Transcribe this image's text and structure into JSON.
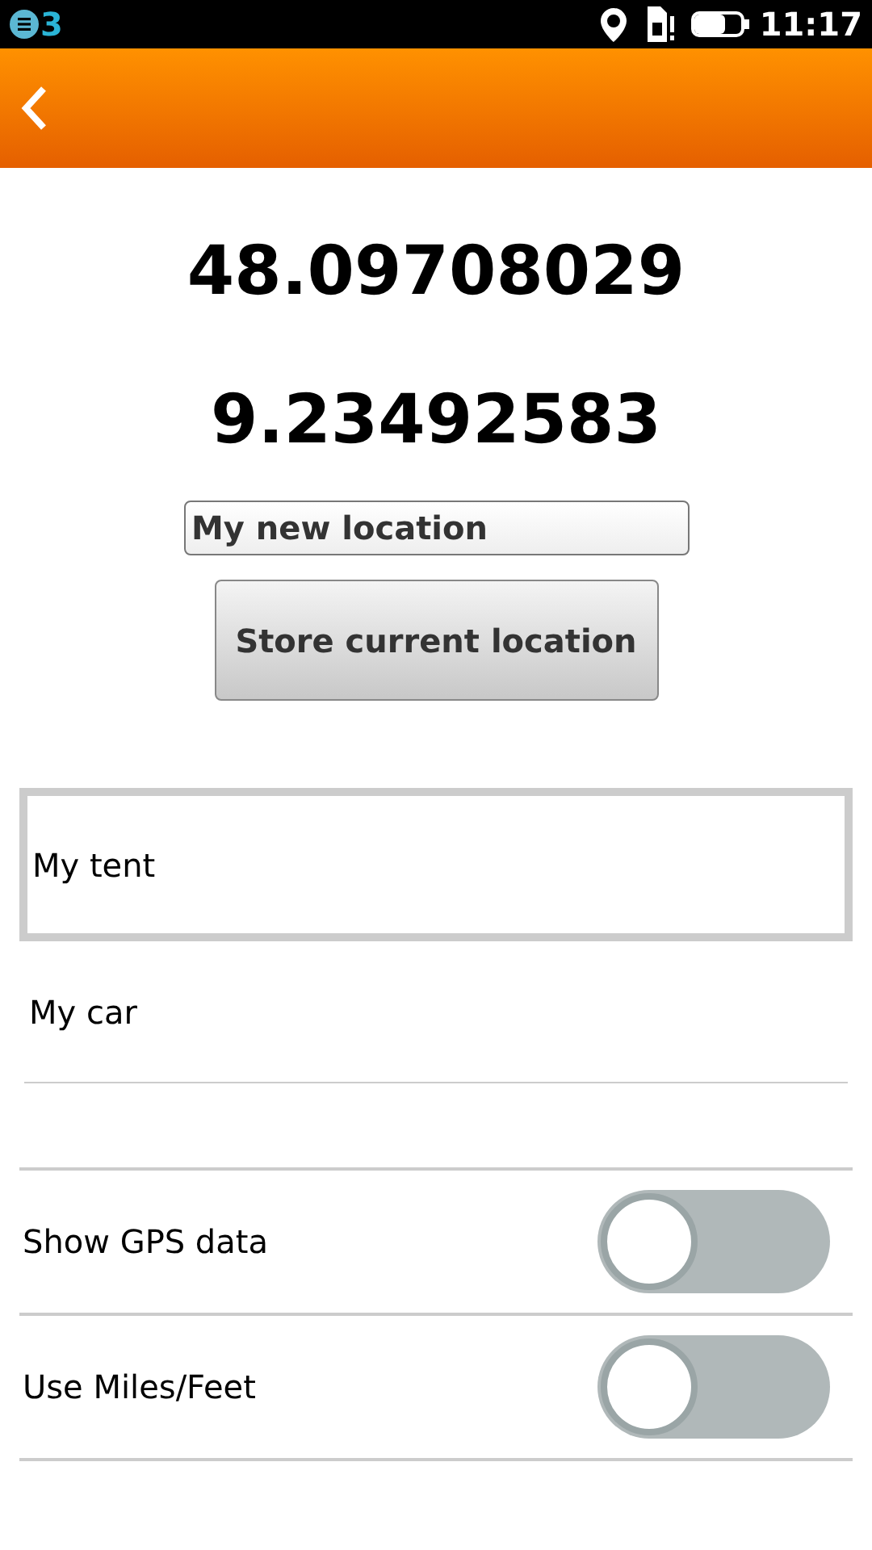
{
  "status_bar": {
    "notification_count": "3",
    "time": "11:17"
  },
  "coordinates": {
    "latitude": "48.09708029",
    "longitude": "9.23492583"
  },
  "name_field": {
    "value": "My new location"
  },
  "store_button": {
    "label": "Store current location"
  },
  "locations": [
    {
      "name": "My tent",
      "selected": true
    },
    {
      "name": "My car",
      "selected": false
    }
  ],
  "settings": [
    {
      "label": "Show GPS data",
      "on": false
    },
    {
      "label": "Use Miles/Feet",
      "on": false
    }
  ]
}
